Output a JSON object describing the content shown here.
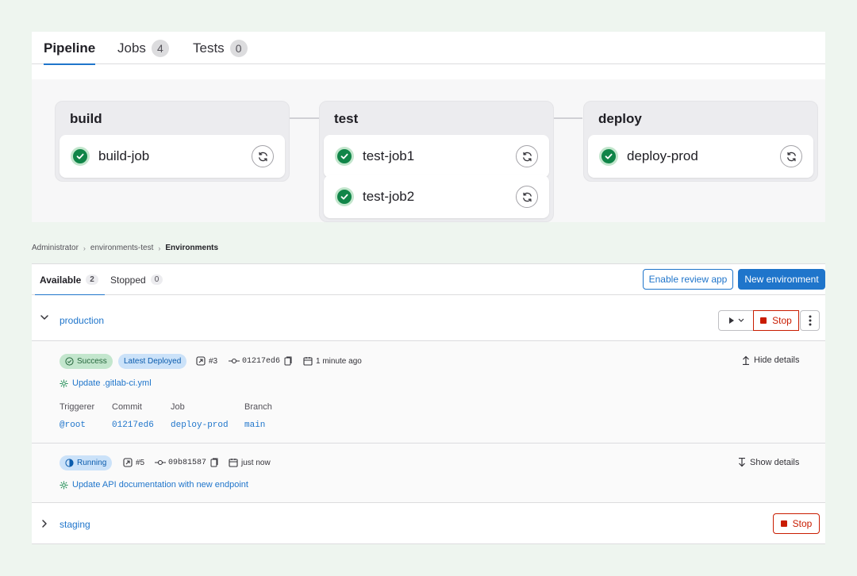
{
  "pipeline": {
    "tabs": [
      {
        "label": "Pipeline",
        "count": ""
      },
      {
        "label": "Jobs",
        "count": "4"
      },
      {
        "label": "Tests",
        "count": "0"
      }
    ],
    "stages": [
      {
        "name": "build",
        "jobs": [
          "build-job"
        ]
      },
      {
        "name": "test",
        "jobs": [
          "test-job1",
          "test-job2"
        ]
      },
      {
        "name": "deploy",
        "jobs": [
          "deploy-prod"
        ]
      }
    ]
  },
  "breadcrumb": [
    "Administrator",
    "environments-test",
    "Environments"
  ],
  "env_tabs": [
    {
      "label": "Available",
      "count": "2"
    },
    {
      "label": "Stopped",
      "count": "0"
    }
  ],
  "actions": {
    "enable_review_app": "Enable review app",
    "new_environment": "New environment"
  },
  "environments": [
    {
      "name": "production",
      "stop_label": "Stop",
      "deployments": [
        {
          "status": "Success",
          "latest_badge": "Latest Deployed",
          "deploy_id": "#3",
          "commit_sha": "01217ed6",
          "time": "1 minute ago",
          "commit_title": "Update .gitlab-ci.yml",
          "toggle": "Hide details",
          "details": {
            "labels": [
              "Triggerer",
              "Commit",
              "Job",
              "Branch"
            ],
            "values": [
              "@root",
              "01217ed6",
              "deploy-prod",
              "main"
            ]
          }
        },
        {
          "status": "Running",
          "deploy_id": "#5",
          "commit_sha": "09b81587",
          "time": "just now",
          "commit_title": "Update API documentation with new endpoint",
          "toggle": "Show details"
        }
      ]
    },
    {
      "name": "staging",
      "stop_label": "Stop"
    }
  ],
  "colors": {
    "accent": "#1f75cb",
    "success": "#108548",
    "danger": "#c91c00",
    "background": "#eef5ef"
  },
  "icons": [
    "check-circle-icon",
    "retry-icon",
    "chevron-down-icon",
    "chevron-right-icon",
    "play-icon",
    "kebab-menu-icon",
    "deployment-icon",
    "commit-icon",
    "copy-icon",
    "calendar-icon",
    "arrow-up-icon",
    "arrow-down-icon",
    "pipeline-status-icon"
  ]
}
